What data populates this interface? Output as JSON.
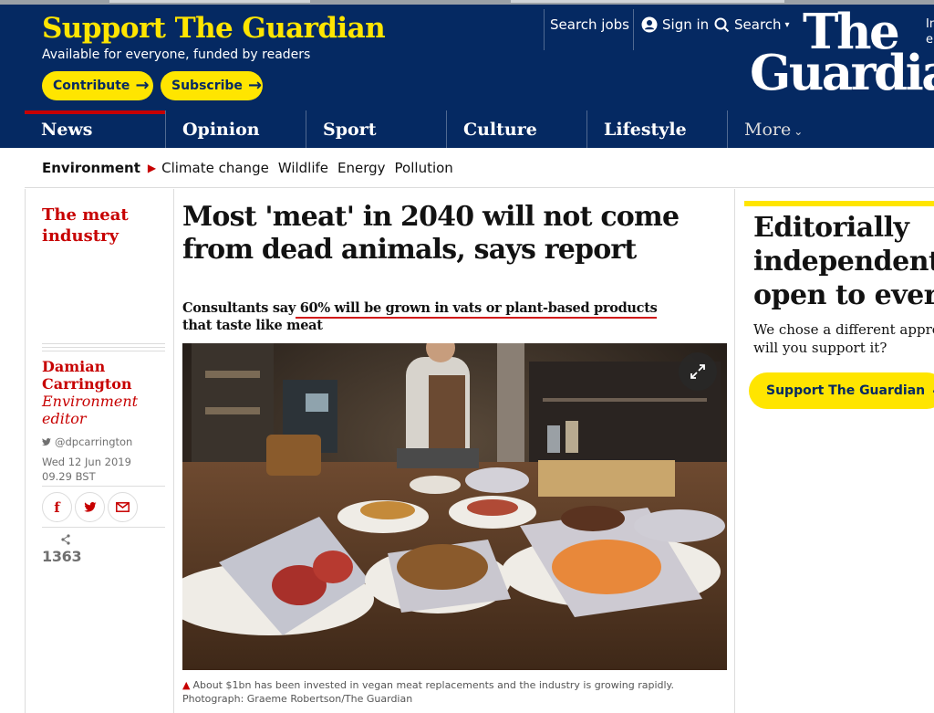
{
  "header": {
    "support_title": "Support The Guardian",
    "support_subtitle": "Available for everyone, funded by readers",
    "contribute_label": "Contribute",
    "subscribe_label": "Subscribe",
    "search_jobs_label": "Search jobs",
    "sign_in_label": "Sign in",
    "search_label": "Search",
    "logo_line1": "The",
    "logo_line2": "Guardian",
    "edge_text_1": "In",
    "edge_text_2": "e"
  },
  "nav": {
    "items": [
      "News",
      "Opinion",
      "Sport",
      "Culture",
      "Lifestyle"
    ],
    "more_label": "More",
    "active": "News"
  },
  "subnav": {
    "section": "Environment",
    "items": [
      "Climate change",
      "Wildlife",
      "Energy",
      "Pollution"
    ]
  },
  "article": {
    "kicker": "The meat industry",
    "headline": "Most 'meat' in 2040 will not come from dead animals, says report",
    "standfirst_pre": "Consultants say",
    "standfirst_highlight": " 60% will be grown in vats or plant-based products",
    "standfirst_post": "that taste like meat",
    "author_name": "Damian Carrington",
    "author_role": "Environment editor",
    "twitter_handle": "@dpcarrington",
    "date": "Wed 12 Jun 2019",
    "time": "09.29 BST",
    "share_count": "1363",
    "caption": "About $1bn has been invested in vegan meat replacements and the industry is growing rapidly. Photograph: Graeme Robertson/The Guardian"
  },
  "support_box": {
    "headline_1": "Editorially",
    "headline_2": "independent",
    "headline_3": "open to every",
    "sub_1": "We chose a different approa",
    "sub_2": "will you support it?",
    "button_label": "Support The Guardian"
  },
  "colors": {
    "brand_blue": "#052962",
    "brand_yellow": "#ffe500",
    "news_red": "#c70000"
  },
  "icons": {
    "account": "account-icon",
    "search": "search-icon",
    "twitter": "twitter-icon",
    "facebook": "facebook-icon",
    "email": "email-icon",
    "share": "share-icon",
    "expand": "expand-icon"
  }
}
